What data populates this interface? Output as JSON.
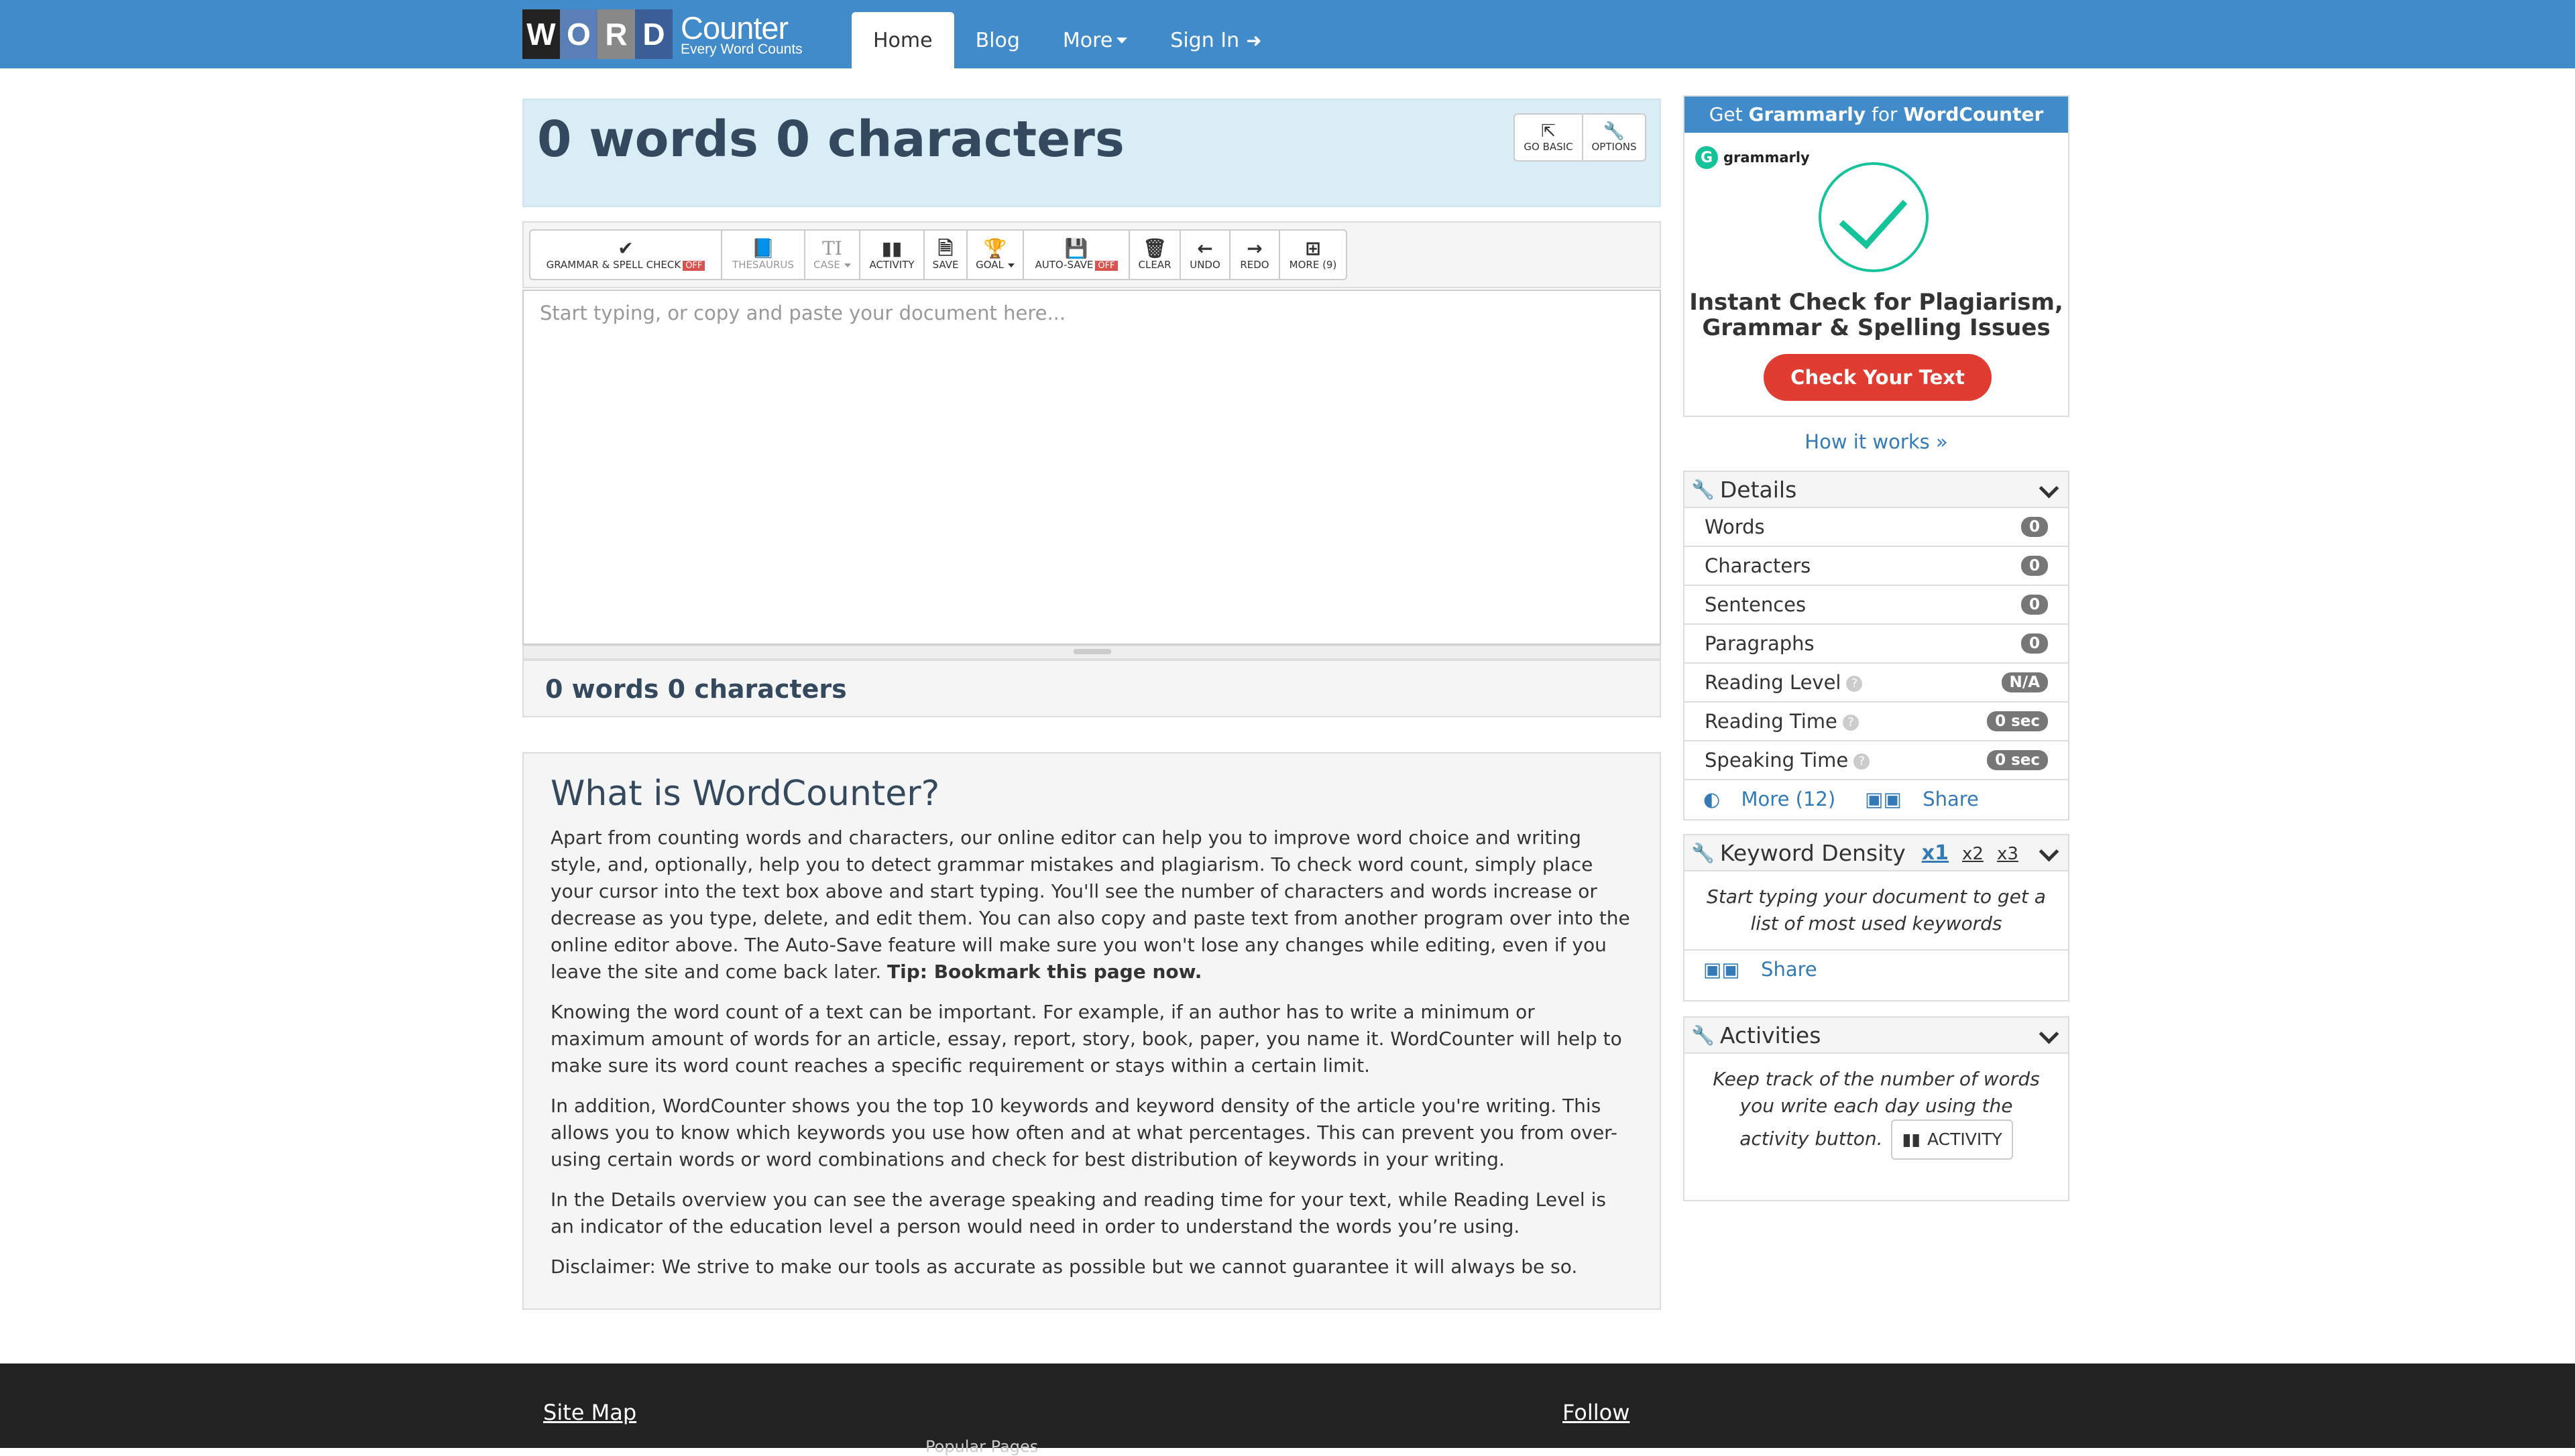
{
  "nav": {
    "logo_letters": [
      "W",
      "O",
      "R",
      "D"
    ],
    "logo_letter_colors": [
      "#222222",
      "#5a7fb6",
      "#888888",
      "#3b5e97"
    ],
    "logo_word": "Counter",
    "logo_tagline": "Every Word Counts",
    "items": [
      {
        "label": "Home",
        "active": true
      },
      {
        "label": "Blog"
      },
      {
        "label": "More"
      },
      {
        "label": "Sign In"
      }
    ]
  },
  "title": {
    "text": "0 words 0 characters",
    "go_basic": "GO BASIC",
    "options": "OPTIONS"
  },
  "toolbar": {
    "grammar": "GRAMMAR & SPELL CHECK",
    "off": "OFF",
    "thesaurus": "THESAURUS",
    "case": "CASE",
    "activity": "ACTIVITY",
    "save": "SAVE",
    "goal": "GOAL",
    "autosave": "AUTO-SAVE",
    "clear": "CLEAR",
    "undo": "UNDO",
    "redo": "REDO",
    "more": "MORE (9)"
  },
  "editor": {
    "placeholder": "Start typing, or copy and paste your document here...",
    "value": ""
  },
  "count_bar": "0 words 0 characters",
  "about": {
    "heading": "What is WordCounter?",
    "p1": "Apart from counting words and characters, our online editor can help you to improve word choice and writing style, and, optionally, help you to detect grammar mistakes and plagiarism. To check word count, simply place your cursor into the text box above and start typing. You'll see the number of characters and words increase or decrease as you type, delete, and edit them. You can also copy and paste text from another program over into the online editor above. The Auto-Save feature will make sure you won't lose any changes while editing, even if you leave the site and come back later.",
    "p1_tip": "Tip: Bookmark this page now.",
    "p2": "Knowing the word count of a text can be important. For example, if an author has to write a minimum or maximum amount of words for an article, essay, report, story, book, paper, you name it. WordCounter will help to make sure its word count reaches a specific requirement or stays within a certain limit.",
    "p3": "In addition, WordCounter shows you the top 10 keywords and keyword density of the article you're writing. This allows you to know which keywords you use how often and at what percentages. This can prevent you from over-using certain words or word combinations and check for best distribution of keywords in your writing.",
    "p4": "In the Details overview you can see the average speaking and reading time for your text, while Reading Level is an indicator of the education level a person would need in order to understand the words you’re using.",
    "p5": "Disclaimer: We strive to make our tools as accurate as possible but we cannot guarantee it will always be so."
  },
  "ad": {
    "head_get": "Get",
    "head_brand": "Grammarly",
    "head_for": "for",
    "head_site": "WordCounter",
    "logo_text": "grammarly",
    "line1": "Instant Check for Plagiarism,",
    "line2": "Grammar & Spelling Issues",
    "button": "Check Your Text",
    "brand_color": "#15c39a"
  },
  "how_it_works": "How it works »",
  "details": {
    "title": "Details",
    "rows": [
      {
        "label": "Words",
        "value": "0"
      },
      {
        "label": "Characters",
        "value": "0"
      },
      {
        "label": "Sentences",
        "value": "0"
      },
      {
        "label": "Paragraphs",
        "value": "0"
      },
      {
        "label": "Reading Level",
        "value": "N/A"
      },
      {
        "label": "Reading Time",
        "value": "0 sec"
      },
      {
        "label": "Speaking Time",
        "value": "0 sec"
      }
    ],
    "more": "More (12)",
    "share": "Share"
  },
  "keyword_density": {
    "title": "Keyword Density",
    "x1": "x1",
    "x2": "x2",
    "x3": "x3",
    "empty": "Start typing your document to get a list of most used keywords",
    "share": "Share"
  },
  "activities": {
    "title": "Activities",
    "text": "Keep track of the number of words you write each day using the activity button.",
    "button": "ACTIVITY"
  },
  "footer": {
    "site_map": "Site Map",
    "follow": "Follow",
    "sub": "Popular Pages"
  }
}
